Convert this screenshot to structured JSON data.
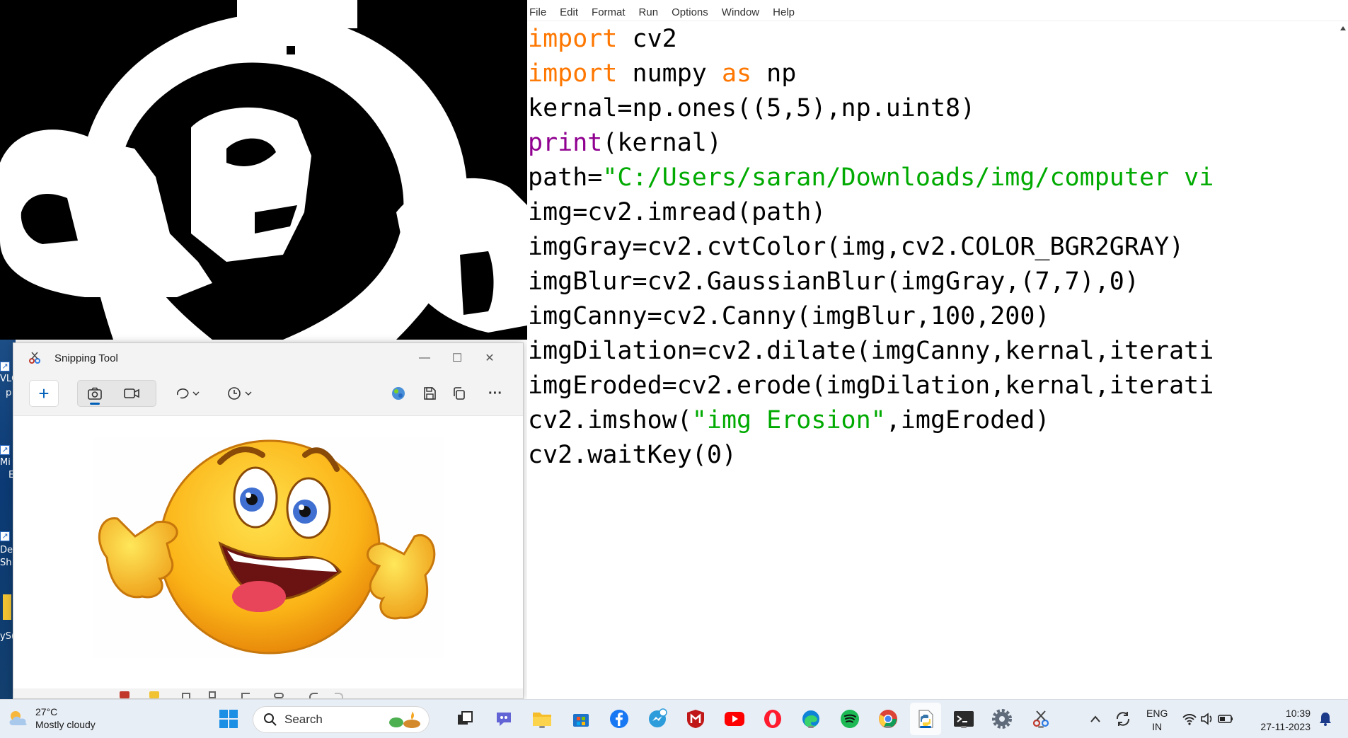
{
  "editor": {
    "menu": [
      "File",
      "Edit",
      "Format",
      "Run",
      "Options",
      "Window",
      "Help"
    ],
    "code_lines": [
      [
        {
          "t": "import",
          "c": "kw"
        },
        {
          "t": " cv2",
          "c": ""
        }
      ],
      [
        {
          "t": "import",
          "c": "kw"
        },
        {
          "t": " numpy ",
          "c": ""
        },
        {
          "t": "as",
          "c": "kw"
        },
        {
          "t": " np",
          "c": ""
        }
      ],
      [
        {
          "t": "kernal=np.ones((5,5),np.uint8)",
          "c": ""
        }
      ],
      [
        {
          "t": "print",
          "c": "bi"
        },
        {
          "t": "(kernal)",
          "c": ""
        }
      ],
      [
        {
          "t": "path=",
          "c": ""
        },
        {
          "t": "\"C:/Users/saran/Downloads/img/computer vi",
          "c": "str"
        }
      ],
      [
        {
          "t": "img=cv2.imread(path)",
          "c": ""
        }
      ],
      [
        {
          "t": "imgGray=cv2.cvtColor(img,cv2.COLOR_BGR2GRAY)",
          "c": ""
        }
      ],
      [
        {
          "t": "imgBlur=cv2.GaussianBlur(imgGray,(7,7),0)",
          "c": ""
        }
      ],
      [
        {
          "t": "imgCanny=cv2.Canny(imgBlur,100,200)",
          "c": ""
        }
      ],
      [
        {
          "t": "imgDilation=cv2.dilate(imgCanny,kernal,iterati",
          "c": ""
        }
      ],
      [
        {
          "t": "imgEroded=cv2.erode(imgDilation,kernal,iterati",
          "c": ""
        }
      ],
      [
        {
          "t": "cv2.imshow(",
          "c": ""
        },
        {
          "t": "\"img Erosion\"",
          "c": "str"
        },
        {
          "t": ",imgEroded)",
          "c": ""
        }
      ],
      [
        {
          "t": "cv2.waitKey(0)",
          "c": ""
        }
      ]
    ]
  },
  "snipping_tool": {
    "title": "Snipping Tool",
    "new_button": "+",
    "minimize": "—",
    "maximize": "☐",
    "close": "✕",
    "more": "···"
  },
  "desktop": {
    "icon_labels": [
      "VLC",
      "p",
      "Mi",
      "E",
      "De",
      "Sh",
      "yS("
    ]
  },
  "taskbar": {
    "weather_temp": "27°C",
    "weather_desc": "Mostly cloudy",
    "search_label": "Search",
    "lang_line1": "ENG",
    "lang_line2": "IN",
    "time": "10:39",
    "date": "27-11-2023"
  },
  "colors": {
    "keyword": "#ff7700",
    "builtin": "#900090",
    "string": "#00aa00",
    "taskbar_bg": "#e8eef6",
    "accent": "#005fb8"
  }
}
